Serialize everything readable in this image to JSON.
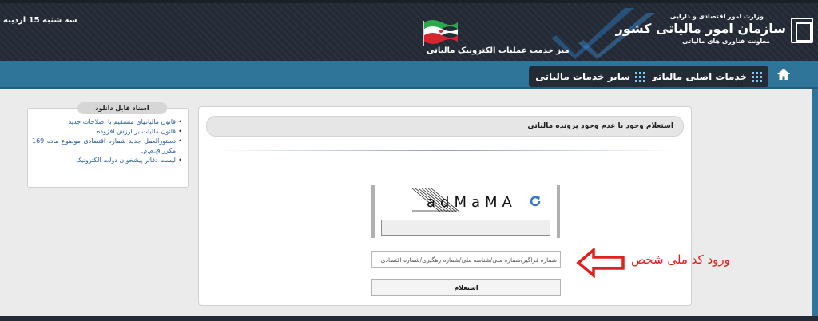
{
  "header": {
    "date": "سه شنبه 15 اردیبه",
    "ministry": "وزارت امور اقتصادی و دارایی",
    "org_name": "سازمان امور مالیاتی کشور",
    "deputy": "معاونت فناوری های مالیاتی",
    "desk_title": "میز خدمت عملیات الکترونیک مالیاتی"
  },
  "nav": {
    "main_services": "خدمات اصلی مالیاتی",
    "other_services": "سایر خدمات مالیاتی"
  },
  "downloads": {
    "title": "اسناد قابل دانلود",
    "items": [
      "قانون مالیاتهای مستقیم با اصلاحات جدید",
      "قانون مالیات بر ارزش افزوده",
      "دستورالعمل جدید شماره اقتصادی موضوع ماده 169 مکرر ق.م.م.",
      "لیست دفاتر پیشخوان دولت الکترونیک"
    ]
  },
  "form": {
    "title": "استعلام وجود یا عدم وجود پرونده مالیاتی",
    "captcha_text": "adMaMA",
    "id_placeholder": "شماره فراگیر/شماره ملی/شناسه ملی/شماره رهگیری/شماره اقتصادی",
    "submit_label": "استعلام"
  },
  "annotation": {
    "text": "ورود کد  ملی شخص",
    "color": "#e0201b"
  },
  "colors": {
    "header_bg": "#232a36",
    "nav_bg": "#2f7499",
    "link": "#2a5ba7"
  }
}
